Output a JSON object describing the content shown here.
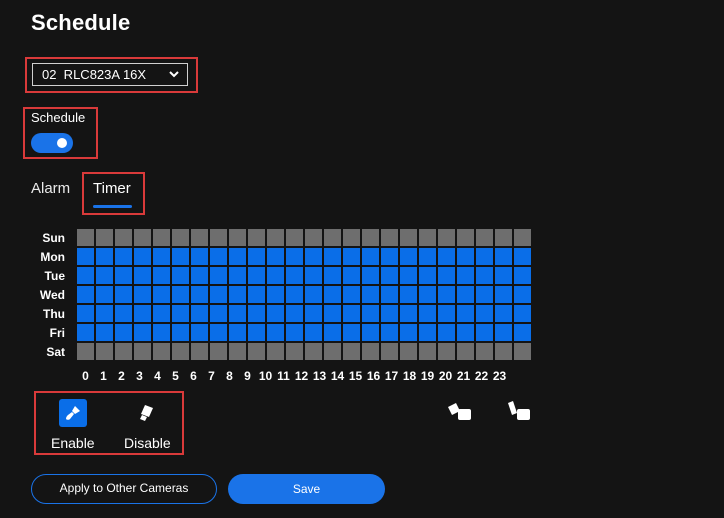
{
  "page": {
    "title": "Schedule"
  },
  "camera_select": {
    "value": "02  RLC823A 16X"
  },
  "schedule_toggle": {
    "label": "Schedule",
    "on": true
  },
  "tabs": [
    {
      "label": "Alarm",
      "active": false
    },
    {
      "label": "Timer",
      "active": true
    }
  ],
  "grid": {
    "days": [
      "Sun",
      "Mon",
      "Tue",
      "Wed",
      "Thu",
      "Fri",
      "Sat"
    ],
    "hours": [
      "0",
      "1",
      "2",
      "3",
      "4",
      "5",
      "6",
      "7",
      "8",
      "9",
      "10",
      "11",
      "12",
      "13",
      "14",
      "15",
      "16",
      "17",
      "18",
      "19",
      "20",
      "21",
      "22",
      "23"
    ],
    "enabled_days": [
      false,
      true,
      true,
      true,
      true,
      true,
      false
    ],
    "colors": {
      "enabled": "#0a6ee8",
      "disabled": "#6e6e6e"
    }
  },
  "tools": {
    "enable_label": "Enable",
    "disable_label": "Disable",
    "icon_enable": "brush-icon",
    "icon_disable": "eraser-icon"
  },
  "actions": {
    "apply_label": "Apply to Other Cameras",
    "save_label": "Save"
  },
  "colors": {
    "accent": "#1a73e8",
    "highlight_box": "#d93a3a",
    "background": "#141414"
  }
}
